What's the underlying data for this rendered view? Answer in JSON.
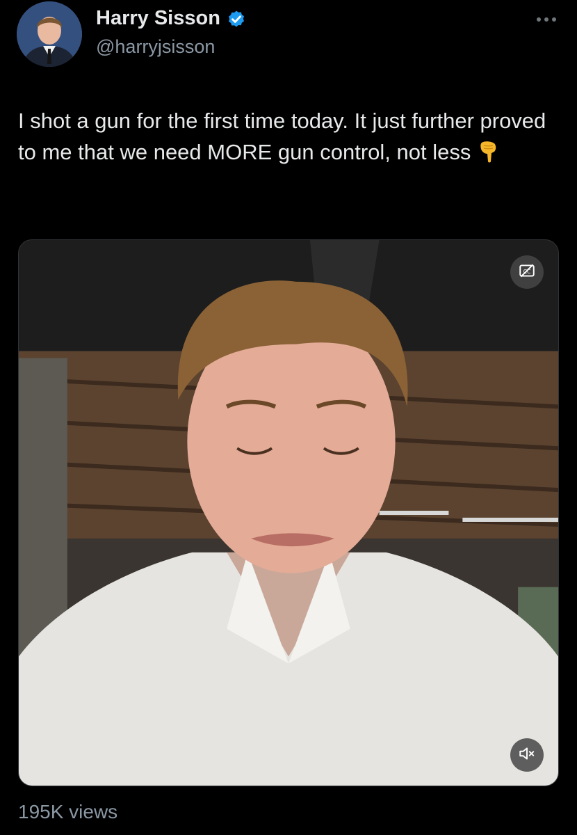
{
  "tweet": {
    "author_name": "Harry Sisson",
    "handle": "@harryjsisson",
    "verified": true,
    "text": "I shot a gun for the first time today. It just further proved to me that we need MORE gun control, not less",
    "emoji": "backhand-index-pointing-down",
    "views": "195K views"
  },
  "media": {
    "type": "video",
    "captions_icon": "closed-captions-icon",
    "mute_icon": "speaker-muted-icon"
  },
  "colors": {
    "background": "#000000",
    "text": "#e7e9ea",
    "secondary_text": "#8b98a5",
    "verified_badge": "#1d9bf0"
  }
}
